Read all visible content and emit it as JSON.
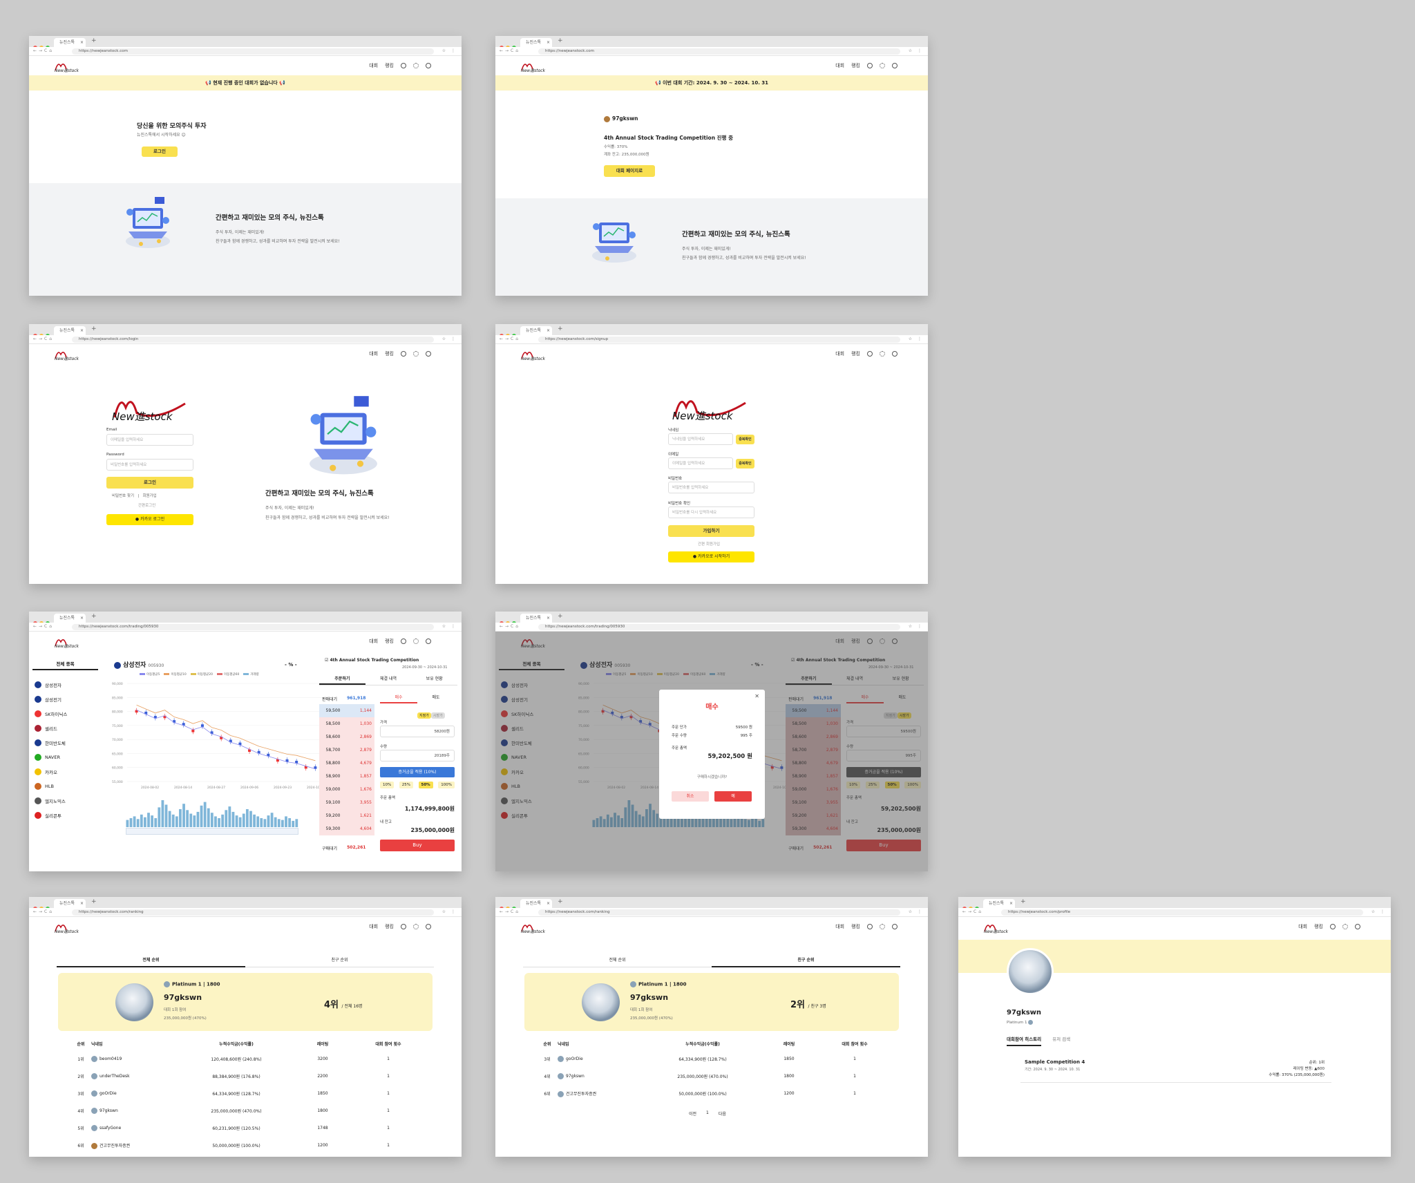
{
  "browser": {
    "tab_title": "뉴진스톡",
    "new_tab": "+"
  },
  "nav": {
    "competition": "대회",
    "ranking": "랭킹"
  },
  "urls": {
    "home": "https://newjeanstock.com",
    "login": "https://newjeanstock.com/login",
    "signup": "https://newjeanstock.com/signup",
    "trading": "https://newjeanstock.com/trading/005930",
    "ranking": "https://newjeanstock.com/ranking",
    "profile": "https://newjeanstock.com/profile"
  },
  "home1": {
    "banner": "📢 현재 진행 중인 대회가 없습니다 📢",
    "headline": "당신을 위한 모의주식 투자",
    "sub": "뉴진스톡에서 시작하세요 😊",
    "login_btn": "로그인"
  },
  "promo": {
    "title": "간편하고 재미있는 모의 주식, 뉴진스톡",
    "line1": "주식 투자, 이제는 재미있게!",
    "line2": "친구들과 함께 경쟁하고, 성과를 비교하며 투자 전략을 발전시켜 보세요!"
  },
  "home2": {
    "banner": "📢 이번 대회 기간: 2024. 9. 30 ~ 2024. 10. 31",
    "user": "97gkswn",
    "comp": "4th Annual Stock Trading Competition 진행 중",
    "rate": "수익률: 370%",
    "balance": "계좌 잔고: 235,000,000원",
    "btn": "대회 페이지로"
  },
  "login": {
    "email_label": "Email",
    "email_ph": "이메일을 입력하세요",
    "pw_label": "Password",
    "pw_ph": "비밀번호를 입력하세요",
    "btn": "로그인",
    "find_pw": "비밀번호 찾기",
    "sep": "|",
    "signup": "회원가입",
    "simple": "간편로그인",
    "kakao": "카카오 로그인"
  },
  "signup": {
    "nick_label": "닉네임",
    "nick_ph": "닉네임을 입력하세요",
    "dup": "중복확인",
    "email_label": "이메일",
    "email_ph": "이메일을 입력하세요",
    "pw_label": "비밀번호",
    "pw_ph": "비밀번호를 입력하세요",
    "pw2_label": "비밀번호 확인",
    "pw2_ph": "비밀번호를 다시 입력하세요",
    "btn": "가입하기",
    "simple": "간편 회원가입",
    "kakao": "카카오로 시작하기"
  },
  "trading": {
    "all_stocks": "전체 종목",
    "stocks": [
      "삼성전자",
      "삼성전기",
      "SK하이닉스",
      "셀리드",
      "한미반도체",
      "NAVER",
      "카카오",
      "HLB",
      "엘지노믹스",
      "실리콘투"
    ],
    "stock_colors": [
      "#1a3a8f",
      "#1a3a8f",
      "#e33",
      "#a23",
      "#1a3a8f",
      "#2a2",
      "#f2c200",
      "#c62",
      "#555",
      "#d22"
    ],
    "name": "삼성전자",
    "code": "005930",
    "unit": "%",
    "legend": [
      "이동평균5",
      "이동평균10",
      "이동평균20",
      "이동평균60",
      "거래량"
    ],
    "yticks": [
      "90,000",
      "85,000",
      "80,000",
      "75,000",
      "70,000",
      "65,000",
      "60,000",
      "55,000"
    ],
    "xticks": [
      "2024-08-02",
      "2024-08-14",
      "2024-08-27",
      "2024-09-06",
      "2024-09-23",
      "2024-10-07"
    ],
    "comp_title": "4th Annual Stock Trading Competition",
    "comp_period": "2024-09-30 ~ 2024-10-31",
    "tabs": [
      "주문하기",
      "체결 내역",
      "보유 현황"
    ],
    "sell_wait": "판매대기",
    "sell_wait_val": "961,918",
    "buy_wait": "구매대기",
    "buy_wait_val": "502,261",
    "book": [
      [
        "59,500",
        "1,144"
      ],
      [
        "58,500",
        "1,030"
      ],
      [
        "58,600",
        "2,869"
      ],
      [
        "58,700",
        "2,879"
      ],
      [
        "58,800",
        "4,679"
      ],
      [
        "58,900",
        "1,857"
      ],
      [
        "59,000",
        "1,676"
      ],
      [
        "59,100",
        "3,955"
      ],
      [
        "59,200",
        "1,621"
      ],
      [
        "59,300",
        "4,604"
      ]
    ],
    "buy_tab": "매수",
    "sell_tab": "매도",
    "limit": "지정가",
    "market": "시장가",
    "price_label": "가격",
    "price_val": "58200원",
    "qty_label": "수량",
    "qty_val": "20189주",
    "apply_btn": "증거금을 적용 (10%)",
    "pcts": [
      "10%",
      "25%",
      "50%",
      "100%"
    ],
    "total_label": "주문 총액",
    "total_val": "1,174,999,800원",
    "balance_label": "내 잔고",
    "balance_val": "235,000,000원",
    "buy_btn": "Buy"
  },
  "modal": {
    "title": "매수",
    "close": "✕",
    "unit_price_label": "주문 단가",
    "unit_price": "59500 원",
    "qty_label": "주문 수량",
    "qty": "995 주",
    "total_label": "주문 총액",
    "total": "59,202,500 원",
    "question": "구매하시겠습니까?",
    "cancel": "취소",
    "ok": "예",
    "price_bg": "59500원",
    "qty_bg": "995주",
    "total_bg": "59,202,500원"
  },
  "ranking": {
    "tab_all": "전체 순위",
    "tab_friend": "친구 순위",
    "tier": "Platinum 1 | 1800",
    "user": "97gkswn",
    "played": "대회 1회 참여",
    "profit": "235,000,000원 (470%)",
    "rank_all": "4위",
    "rank_all_total": "/ 전체 16명",
    "rank_friend": "2위",
    "rank_friend_total": "/ 친구 3명",
    "headers": [
      "순위",
      "닉네임",
      "누적수익금(수익률)",
      "레이팅",
      "대회 참여 횟수"
    ],
    "rows": [
      [
        "1위",
        "beom0419",
        "120,408,600원 (240.8%)",
        "3200",
        "1"
      ],
      [
        "2위",
        "underTheDesk",
        "88,384,900원 (176.8%)",
        "2200",
        "1"
      ],
      [
        "3위",
        "goOrDie",
        "64,334,900원 (128.7%)",
        "1850",
        "1"
      ],
      [
        "4위",
        "97gkswn",
        "235,000,000원 (470.0%)",
        "1800",
        "1"
      ],
      [
        "5위",
        "ssafyGone",
        "60,231,900원 (120.5%)",
        "1748",
        "1"
      ],
      [
        "6위",
        "건고무진투자증권",
        "50,000,000원 (100.0%)",
        "1200",
        "1"
      ]
    ],
    "friend_rows": [
      [
        "3위",
        "goOrDie",
        "64,334,900원 (128.7%)",
        "1850",
        "1"
      ],
      [
        "4위",
        "97gkswn",
        "235,000,000원 (470.0%)",
        "1800",
        "1"
      ],
      [
        "6위",
        "건고무진투자증권",
        "50,000,000원 (100.0%)",
        "1200",
        "1"
      ]
    ],
    "prev": "이전",
    "page": "1",
    "next": "다음"
  },
  "profile": {
    "user": "97gkswn",
    "tier": "Platinum 1",
    "tab_history": "대회참여 히스토리",
    "tab_search": "유저 검색",
    "comp_name": "Sample Competition 4",
    "comp_period": "기간: 2024. 9. 30 ~ 2024. 10. 31",
    "rank": "순위: 1위",
    "rating_change": "레이팅 변동: ▲600",
    "rate": "수익률: 370% (235,000,000원)"
  },
  "colors": {
    "accent_yellow": "#f9e050",
    "banner": "#fcf4c4",
    "buy_red": "#e94040",
    "blue": "#3a78d8"
  },
  "chart_data": {
    "type": "line",
    "title": "",
    "series": [
      {
        "name": "삼성전자",
        "values": [
          80500,
          79000,
          77500,
          78500,
          76000,
          75000,
          73500,
          74500,
          72000,
          71000,
          69000,
          68000,
          66500,
          65000,
          64000,
          63000,
          62000,
          61500,
          60500,
          59500
        ]
      }
    ],
    "ylim": [
      55000,
      90000
    ]
  }
}
